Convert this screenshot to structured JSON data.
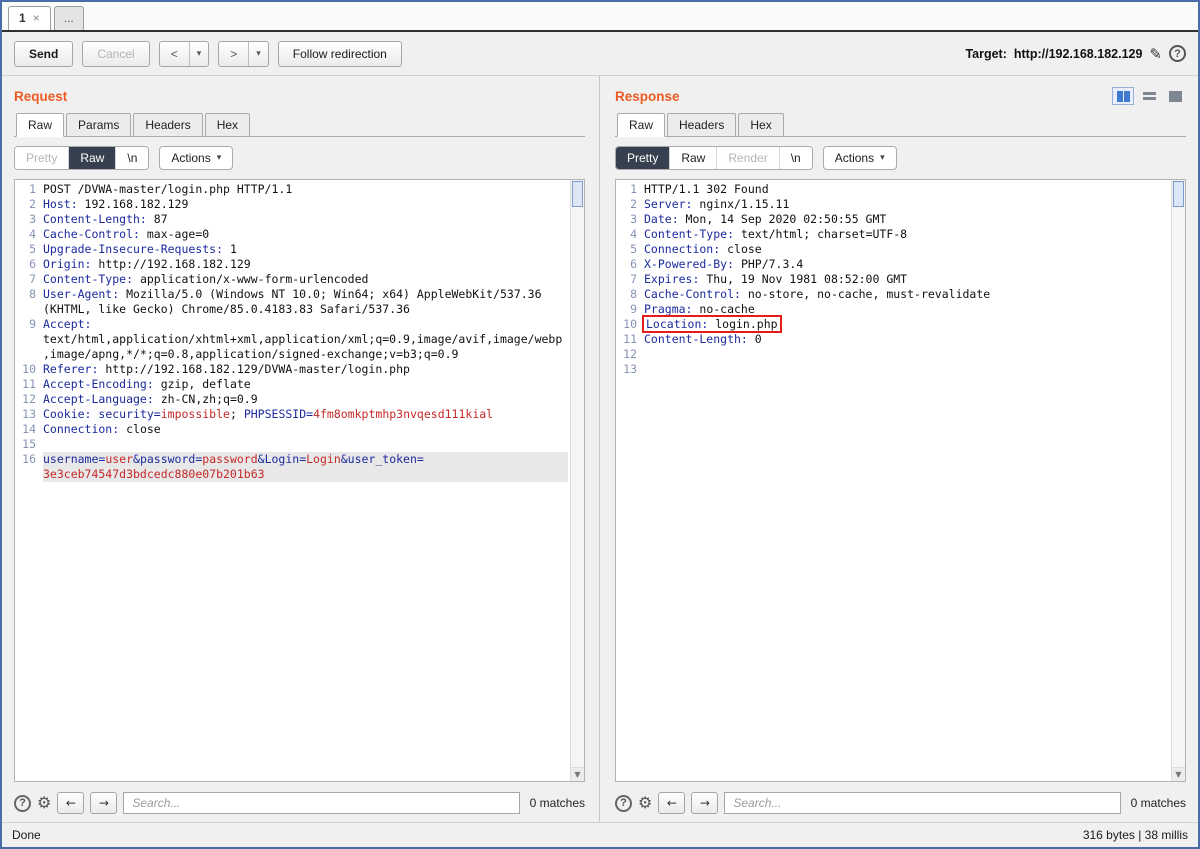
{
  "colors": {
    "accent_orange": "#ee5b22",
    "header_name_blue": "#1b2a9e",
    "param_value_red": "#c62828",
    "annotation_red": "#e41c1c",
    "active_view_bg": "#37404f",
    "layout_icon_blue": "#3f7ad1"
  },
  "icons": {
    "help": "?",
    "settings": "⚙",
    "prev": "←",
    "next": "→",
    "scroll_down": "▼",
    "dropdown": "▾",
    "pencil": "✎",
    "close": "×"
  },
  "tab_bar": {
    "tab1_label": "1",
    "more_tab": "..."
  },
  "toolbar": {
    "send": "Send",
    "cancel": "Cancel",
    "back_arrow": "<",
    "forward_arrow": ">",
    "follow_redirection": "Follow redirection",
    "target_label": "Target:",
    "target_url": "http://192.168.182.129"
  },
  "request": {
    "title": "Request",
    "tabs": [
      "Raw",
      "Params",
      "Headers",
      "Hex"
    ],
    "active_tab": "Raw",
    "views": [
      {
        "label": "Pretty",
        "state": "disabled"
      },
      {
        "label": "Raw",
        "state": "active"
      },
      {
        "label": "\\n",
        "state": "normal"
      }
    ],
    "actions_label": "Actions",
    "search": {
      "placeholder": "Search...",
      "matches": "0 matches"
    },
    "lines": [
      {
        "n": 1,
        "seg": [
          [
            "POST /DVWA-master/login.php HTTP/1.1",
            "p"
          ]
        ]
      },
      {
        "n": 2,
        "seg": [
          [
            "Host:",
            "h"
          ],
          [
            " 192.168.182.129",
            "p"
          ]
        ]
      },
      {
        "n": 3,
        "seg": [
          [
            "Content-Length:",
            "h"
          ],
          [
            " 87",
            "p"
          ]
        ]
      },
      {
        "n": 4,
        "seg": [
          [
            "Cache-Control:",
            "h"
          ],
          [
            " max-age=0",
            "p"
          ]
        ]
      },
      {
        "n": 5,
        "seg": [
          [
            "Upgrade-Insecure-Requests:",
            "h"
          ],
          [
            " 1",
            "p"
          ]
        ]
      },
      {
        "n": 6,
        "seg": [
          [
            "Origin:",
            "h"
          ],
          [
            " http://192.168.182.129",
            "p"
          ]
        ]
      },
      {
        "n": 7,
        "seg": [
          [
            "Content-Type:",
            "h"
          ],
          [
            " application/x-www-form-urlencoded",
            "p"
          ]
        ]
      },
      {
        "n": 8,
        "seg": [
          [
            "User-Agent:",
            "h"
          ],
          [
            " Mozilla/5.0 (Windows NT 10.0; Win64; x64) AppleWebKit/537.36 (KHTML, like Gecko) Chrome/85.0.4183.83 Safari/537.36",
            "p"
          ]
        ]
      },
      {
        "n": 9,
        "seg": [
          [
            "Accept:",
            "h"
          ],
          [
            " text/html,application/xhtml+xml,application/xml;q=0.9,image/avif,image/webp,image/apng,*/*;q=0.8,application/signed-exchange;v=b3;q=0.9",
            "p"
          ]
        ]
      },
      {
        "n": 10,
        "seg": [
          [
            "Referer:",
            "h"
          ],
          [
            " http://192.168.182.129/DVWA-master/login.php",
            "p"
          ]
        ]
      },
      {
        "n": 11,
        "seg": [
          [
            "Accept-Encoding:",
            "h"
          ],
          [
            " gzip, deflate",
            "p"
          ]
        ]
      },
      {
        "n": 12,
        "seg": [
          [
            "Accept-Language:",
            "h"
          ],
          [
            " zh-CN,zh;q=0.9",
            "p"
          ]
        ]
      },
      {
        "n": 13,
        "seg": [
          [
            "Cookie:",
            "h"
          ],
          [
            " ",
            "p"
          ],
          [
            "security=",
            "h"
          ],
          [
            "impossible",
            "v"
          ],
          [
            "; ",
            "p"
          ],
          [
            "PHPSESSID=",
            "h"
          ],
          [
            "4fm8omkptmhp3nvqesd111kial",
            "v"
          ]
        ]
      },
      {
        "n": 14,
        "seg": [
          [
            "Connection:",
            "h"
          ],
          [
            " close",
            "p"
          ]
        ]
      },
      {
        "n": 15,
        "seg": []
      },
      {
        "n": 16,
        "hl": true,
        "seg": [
          [
            "username=",
            "h"
          ],
          [
            "user",
            "v"
          ],
          [
            "&password=",
            "h"
          ],
          [
            "password",
            "v"
          ],
          [
            "&Login=",
            "h"
          ],
          [
            "Login",
            "v"
          ],
          [
            "&user_token=",
            "h"
          ],
          [
            "3e3ceb74547d3bdcedc880e07b201b63",
            "v"
          ]
        ]
      }
    ]
  },
  "response": {
    "title": "Response",
    "tabs": [
      "Raw",
      "Headers",
      "Hex"
    ],
    "active_tab": "Raw",
    "views": [
      {
        "label": "Pretty",
        "state": "active"
      },
      {
        "label": "Raw",
        "state": "normal"
      },
      {
        "label": "Render",
        "state": "disabled"
      },
      {
        "label": "\\n",
        "state": "normal"
      }
    ],
    "actions_label": "Actions",
    "layout_buttons": [
      "columns",
      "rows",
      "single"
    ],
    "active_layout": "columns",
    "search": {
      "placeholder": "Search...",
      "matches": "0 matches"
    },
    "lines": [
      {
        "n": 1,
        "seg": [
          [
            "HTTP/1.1 302 Found",
            "p"
          ]
        ]
      },
      {
        "n": 2,
        "seg": [
          [
            "Server:",
            "h"
          ],
          [
            " nginx/1.15.11",
            "p"
          ]
        ]
      },
      {
        "n": 3,
        "seg": [
          [
            "Date:",
            "h"
          ],
          [
            " Mon, 14 Sep 2020 02:50:55 GMT",
            "p"
          ]
        ]
      },
      {
        "n": 4,
        "seg": [
          [
            "Content-Type:",
            "h"
          ],
          [
            " text/html; charset=UTF-8",
            "p"
          ]
        ]
      },
      {
        "n": 5,
        "seg": [
          [
            "Connection:",
            "h"
          ],
          [
            " close",
            "p"
          ]
        ]
      },
      {
        "n": 6,
        "seg": [
          [
            "X-Powered-By:",
            "h"
          ],
          [
            " PHP/7.3.4",
            "p"
          ]
        ]
      },
      {
        "n": 7,
        "seg": [
          [
            "Expires:",
            "h"
          ],
          [
            " Thu, 19 Nov 1981 08:52:00 GMT",
            "p"
          ]
        ]
      },
      {
        "n": 8,
        "seg": [
          [
            "Cache-Control:",
            "h"
          ],
          [
            " no-store, no-cache, must-revalidate",
            "p"
          ]
        ]
      },
      {
        "n": 9,
        "seg": [
          [
            "Pragma:",
            "h"
          ],
          [
            " no-cache",
            "p"
          ]
        ]
      },
      {
        "n": 10,
        "box": true,
        "seg": [
          [
            "Location:",
            "h"
          ],
          [
            " login.php",
            "p"
          ]
        ]
      },
      {
        "n": 11,
        "seg": [
          [
            "Content-Length:",
            "h"
          ],
          [
            " 0",
            "p"
          ]
        ]
      },
      {
        "n": 12,
        "seg": []
      },
      {
        "n": 13,
        "seg": []
      }
    ]
  },
  "status_bar": {
    "left": "Done",
    "right": "316 bytes | 38 millis"
  }
}
